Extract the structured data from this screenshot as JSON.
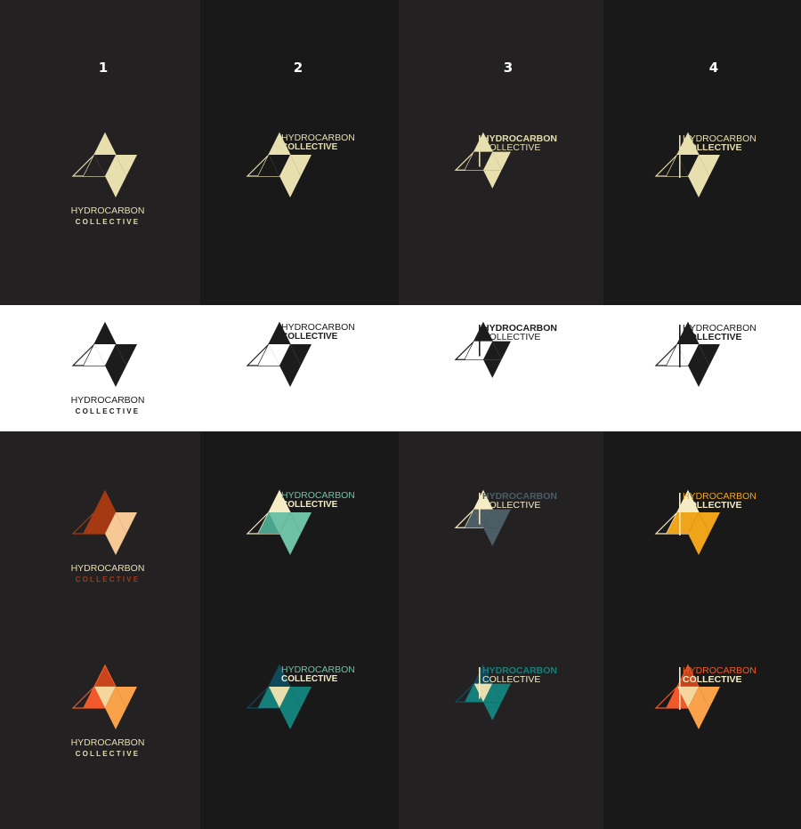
{
  "column_numbers": [
    "1",
    "2",
    "3",
    "4"
  ],
  "brand": {
    "line1": "HYDROCARBON",
    "line2": "COLLECTIVE"
  },
  "colors": {
    "page_dark": "#232122",
    "page_darker": "#1a191a",
    "band_light": "#ffffff",
    "cream": "#e8dfae",
    "ink": "#1c1c1c",
    "rust": "#a53a12",
    "peach": "#f6c896",
    "coral": "#f2592a",
    "orange_light": "#f9a24a",
    "sand": "#f5d79d",
    "mint": "#6fc1a6",
    "mint_dark": "#4aa48c",
    "teal_dark": "#0f4a5c",
    "teal": "#15807a",
    "slate": "#4c5d66",
    "gold": "#f0a419",
    "pale_yellow": "#f5ecc4"
  },
  "logo_rows": [
    [
      {
        "name": "dark-1",
        "layout": "stacked",
        "outline": "#e8dfae",
        "fills": [
          "#e8dfae",
          "#e8dfae",
          "#e8dfae"
        ],
        "darks": [
          "#232122",
          "#232122"
        ],
        "line1_color": "#e8dfae",
        "line2_color": "#e8dfae"
      },
      {
        "name": "dark-2",
        "layout": "side",
        "outline": "#e8dfae",
        "fills": [
          "#e8dfae",
          "#e8dfae",
          "#e8dfae"
        ],
        "darks": [
          "#1a191a",
          "#1a191a"
        ],
        "line1_color": "#e8dfae",
        "line2_color": "#e8dfae"
      },
      {
        "name": "dark-3",
        "layout": "side-bar",
        "outline": "#e8dfae",
        "fills": [
          "#e8dfae",
          "#e8dfae",
          "#e8dfae"
        ],
        "darks": [
          "#232122",
          "#232122"
        ],
        "line1_color": "#e8dfae",
        "line2_color": "#e8dfae"
      },
      {
        "name": "dark-4",
        "layout": "side-bar",
        "outline": "#e8dfae",
        "fills": [
          "#e8dfae",
          "#e8dfae",
          "#e8dfae"
        ],
        "darks": [
          "#1a191a",
          "#1a191a"
        ],
        "line1_color": "#e8dfae",
        "line2_color": "#e8dfae"
      }
    ],
    [
      {
        "name": "light-1",
        "layout": "stacked",
        "outline": "#1c1c1c",
        "fills": [
          "#1c1c1c",
          "#1c1c1c",
          "#1c1c1c"
        ],
        "darks": [
          "#ffffff",
          "#ffffff"
        ],
        "line1_color": "#1c1c1c",
        "line2_color": "#1c1c1c"
      },
      {
        "name": "light-2",
        "layout": "side",
        "outline": "#1c1c1c",
        "fills": [
          "#1c1c1c",
          "#1c1c1c",
          "#1c1c1c"
        ],
        "darks": [
          "#ffffff",
          "#ffffff"
        ],
        "line1_color": "#1c1c1c",
        "line2_color": "#1c1c1c"
      },
      {
        "name": "light-3",
        "layout": "side-bar",
        "outline": "#1c1c1c",
        "fills": [
          "#1c1c1c",
          "#1c1c1c",
          "#1c1c1c"
        ],
        "darks": [
          "#ffffff",
          "#ffffff"
        ],
        "line1_color": "#1c1c1c",
        "line2_color": "#1c1c1c"
      },
      {
        "name": "light-4",
        "layout": "side-bar",
        "outline": "#1c1c1c",
        "fills": [
          "#1c1c1c",
          "#1c1c1c",
          "#1c1c1c"
        ],
        "darks": [
          "#ffffff",
          "#ffffff"
        ],
        "line1_color": "#1c1c1c",
        "line2_color": "#1c1c1c"
      }
    ],
    [
      {
        "name": "color-a-1",
        "layout": "stacked",
        "outline": "#a53a12",
        "fills": [
          "#a53a12",
          "#f6c896",
          "#f6c896"
        ],
        "darks": [
          "#a53a12",
          "#a53a12"
        ],
        "line1_color": "#e8dfae",
        "line2_color": "#a53a12"
      },
      {
        "name": "color-a-2",
        "layout": "side",
        "outline": "#f5ecc4",
        "fills": [
          "#f5ecc4",
          "#6fc1a6",
          "#6fc1a6"
        ],
        "darks": [
          "#6fc1a6",
          "#4aa48c"
        ],
        "line1_color": "#6fc1a6",
        "line2_color": "#f5ecc4"
      },
      {
        "name": "color-a-3",
        "layout": "side-bar",
        "outline": "#f5ecc4",
        "fills": [
          "#f5ecc4",
          "#4c5d66",
          "#4c5d66"
        ],
        "darks": [
          "#4c5d66",
          "#4c5d66"
        ],
        "line1_color": "#4c5d66",
        "line2_color": "#f5ecc4"
      },
      {
        "name": "color-a-4",
        "layout": "side-bar",
        "outline": "#f5ecc4",
        "fills": [
          "#f5ecc4",
          "#f0a419",
          "#f0a419"
        ],
        "darks": [
          "#f0a419",
          "#f0a419"
        ],
        "line1_color": "#f0a419",
        "line2_color": "#f5ecc4"
      }
    ],
    [
      {
        "name": "color-b-1",
        "layout": "stacked",
        "outline": "#f2592a",
        "fills": [
          "#c8441a",
          "#f9a24a",
          "#f9a24a"
        ],
        "darks": [
          "#f5d79d",
          "#f2592a"
        ],
        "line1_color": "#e8dfae",
        "line2_color": "#e8dfae"
      },
      {
        "name": "color-b-2",
        "layout": "side",
        "outline": "#0f4a5c",
        "fills": [
          "#0f4a5c",
          "#15807a",
          "#15807a"
        ],
        "darks": [
          "#e8dfae",
          "#15807a"
        ],
        "line1_color": "#6fc1a6",
        "line2_color": "#f5ecc4"
      },
      {
        "name": "color-b-3",
        "layout": "side-bar",
        "outline": "#0f4a5c",
        "fills": [
          "#0f4a5c",
          "#15807a",
          "#15807a"
        ],
        "darks": [
          "#e8dfae",
          "#15807a"
        ],
        "line1_color": "#15807a",
        "line2_color": "#f5ecc4"
      },
      {
        "name": "color-b-4",
        "layout": "side-bar",
        "outline": "#f2592a",
        "fills": [
          "#c8441a",
          "#f9a24a",
          "#f9a24a"
        ],
        "darks": [
          "#f5d79d",
          "#f2592a"
        ],
        "line1_color": "#f2592a",
        "line2_color": "#f5ecc4"
      }
    ]
  ]
}
